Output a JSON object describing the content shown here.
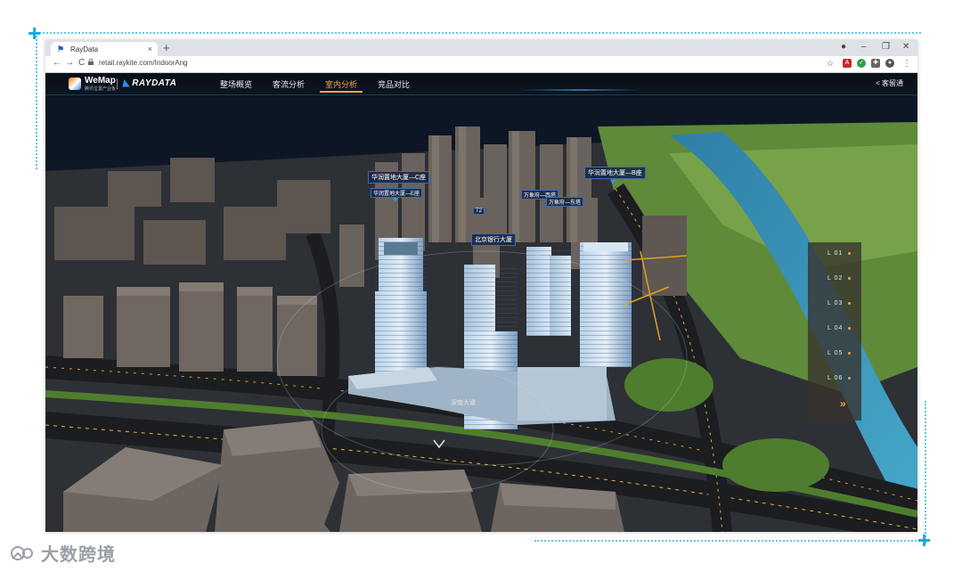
{
  "browser": {
    "tab_title": "RayData",
    "tab_close": "×",
    "new_tab": "+",
    "url": "retail.raykite.com/IndoorAng",
    "nav_back": "←",
    "nav_forward": "→",
    "nav_reload": "C",
    "win_minimize": "–",
    "win_restore": "❐",
    "win_close": "✕",
    "star": "☆",
    "menu": "⋮"
  },
  "app": {
    "logo_wemap": "WeMap",
    "logo_wemap_sub": "腾讯位置产业板",
    "logo_raydata": "RAYDATA",
    "nav_tabs": [
      {
        "label": "整场概览",
        "active": false
      },
      {
        "label": "客流分析",
        "active": false
      },
      {
        "label": "室内分析",
        "active": true
      },
      {
        "label": "竞品对比",
        "active": false
      }
    ],
    "back_link": "< 客留通"
  },
  "buildings": {
    "label_c": "华润置地大厦—C座",
    "label_c_sub": "华润置地大厦—E座",
    "label_b": "华润置地大厦—B座",
    "label_bank": "北京银行大厦",
    "label_west": "万象府—西塔",
    "label_east": "万象府—东塔",
    "label_small": "T2",
    "road_label": "深南大道"
  },
  "floors": {
    "items": [
      "L 01",
      "L 02",
      "L 03",
      "L 04",
      "L 05",
      "L 06"
    ],
    "more": "»"
  },
  "watermark": {
    "text": "大数跨境"
  },
  "colors": {
    "accent": "#f0a64a",
    "frame": "#1aa7e0",
    "label_border": "#3a6db0"
  }
}
